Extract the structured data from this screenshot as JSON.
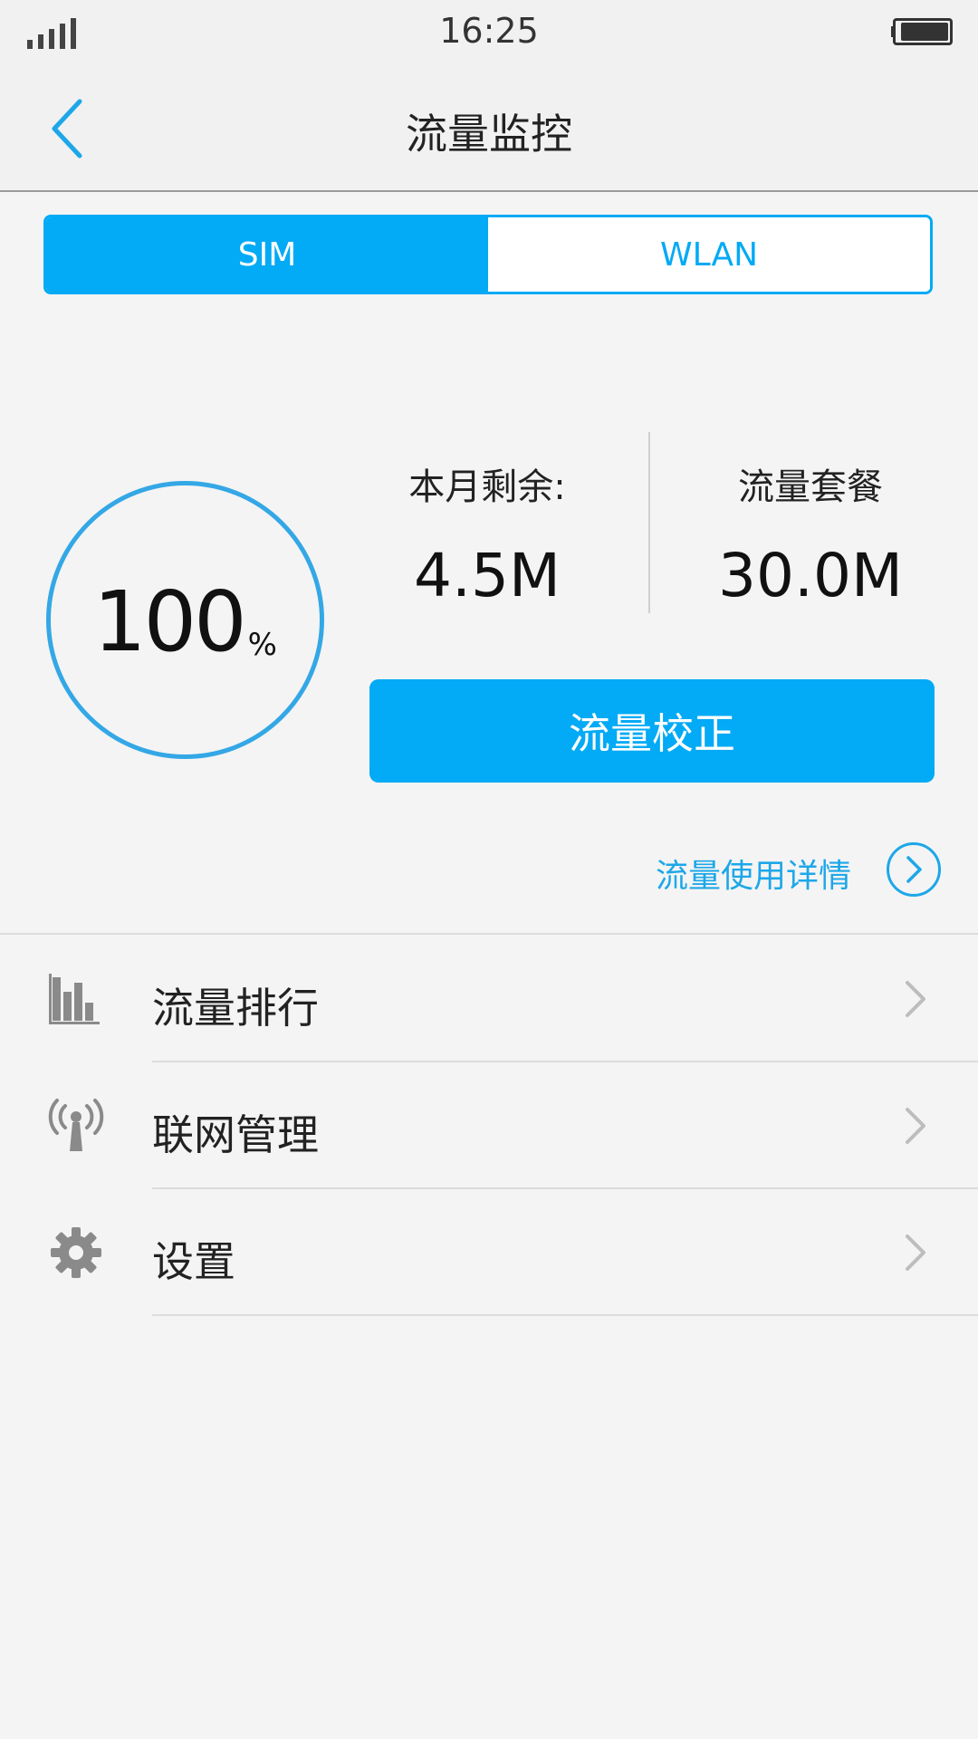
{
  "status_bar": {
    "time": "16:25",
    "signal_icon": "signal-icon",
    "battery_icon": "battery-icon"
  },
  "nav": {
    "title": "流量监控",
    "back_icon": "back-chevron-icon"
  },
  "tabs": [
    {
      "label": "SIM",
      "active": true
    },
    {
      "label": "WLAN",
      "active": false
    }
  ],
  "usage": {
    "percent": "100",
    "percent_unit": "%",
    "remaining_label": "本月剩余:",
    "remaining_value": "4.5M",
    "plan_label": "流量套餐",
    "plan_value": "30.0M"
  },
  "calibrate_button": "流量校正",
  "detail_link": {
    "label": "流量使用详情",
    "icon": "circle-chevron-right-icon"
  },
  "menu": [
    {
      "label": "流量排行",
      "icon": "bar-chart-icon"
    },
    {
      "label": "联网管理",
      "icon": "antenna-icon"
    },
    {
      "label": "设置",
      "icon": "gear-icon"
    }
  ],
  "colors": {
    "accent": "#03aaf5",
    "ring": "#34a7e6",
    "chevron": "#bdbdbd",
    "icon": "#8a8a8a"
  }
}
